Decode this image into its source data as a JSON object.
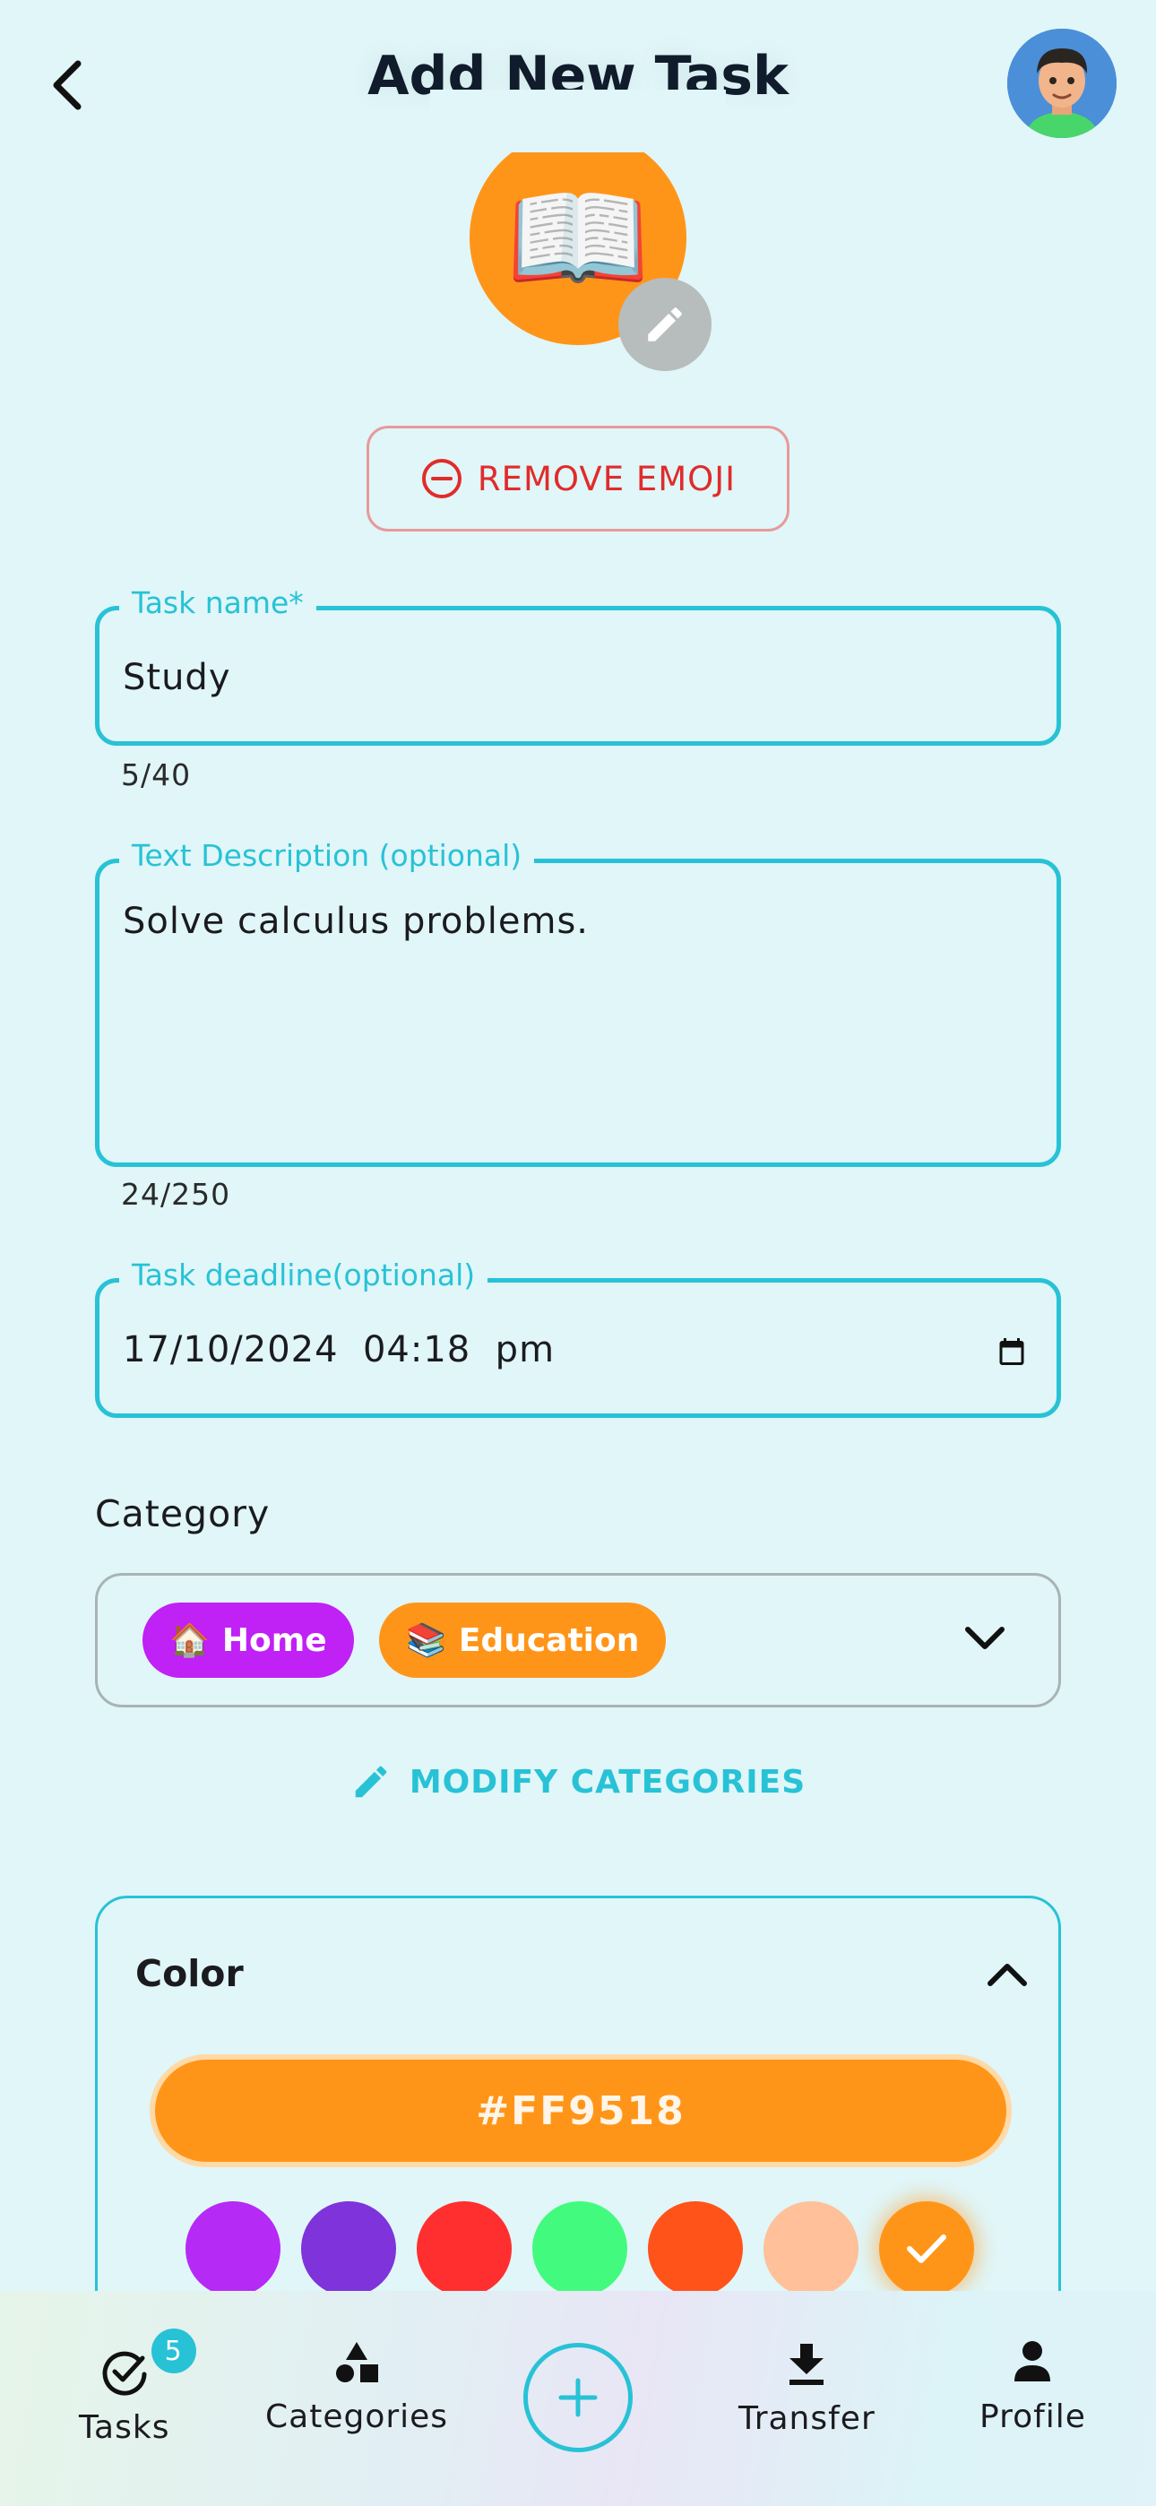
{
  "header": {
    "title": "Add New Task",
    "back_icon": "chevron-left-icon",
    "avatar_icon": "user-avatar"
  },
  "emoji": {
    "glyph": "📖",
    "background_color": "#FF9518",
    "edit_icon": "pencil-icon",
    "remove_label": "REMOVE EMOJI",
    "remove_icon": "minus-circle-icon"
  },
  "task_name": {
    "label": "Task name*",
    "value": "Study",
    "counter": "5/40"
  },
  "description": {
    "label": "Text Description (optional)",
    "value": "Solve calculus problems.",
    "counter": "24/250"
  },
  "deadline": {
    "label": "Task deadline(optional)",
    "value": "17/10/2024  04:18  pm",
    "icon": "calendar-icon"
  },
  "category": {
    "label": "Category",
    "chips": [
      {
        "emoji": "🏠",
        "label": "Home",
        "color": "#C021F5"
      },
      {
        "emoji": "📚",
        "label": "Education",
        "color": "#FF9518"
      }
    ],
    "dropdown_icon": "chevron-down-icon",
    "modify_label": "MODIFY CATEGORIES",
    "modify_icon": "pencil-icon"
  },
  "color": {
    "title": "Color",
    "collapse_icon": "chevron-up-icon",
    "selected_hex": "#FF9518",
    "swatches": [
      "#B62AF5",
      "#7E33DB",
      "#FF2F2F",
      "#42FB7E",
      "#FF531A",
      "#FFC09A",
      "#FF9518"
    ],
    "selected_index": 6
  },
  "bottom_nav": {
    "items": [
      {
        "label": "Tasks",
        "icon": "check-circle-icon",
        "badge": "5"
      },
      {
        "label": "Categories",
        "icon": "shapes-icon"
      },
      {
        "label": "",
        "icon": "plus-circle-icon"
      },
      {
        "label": "Transfer",
        "icon": "download-icon"
      },
      {
        "label": "Profile",
        "icon": "person-icon"
      }
    ]
  }
}
